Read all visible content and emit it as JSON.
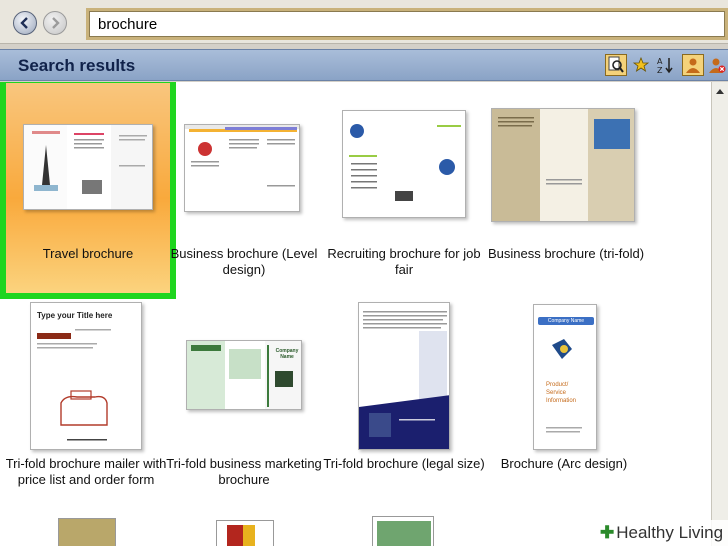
{
  "address": {
    "value": "brochure"
  },
  "header": {
    "title": "Search results"
  },
  "toolbar": {
    "view_icon": "magnifier-icon",
    "favorite_icon": "star-icon",
    "sort_icon": "sort-az-icon",
    "user_icon": "user-icon",
    "remove_user_icon": "user-remove-icon"
  },
  "templates": [
    {
      "label": "Travel brochure",
      "selected": true
    },
    {
      "label": "Business brochure (Level design)"
    },
    {
      "label": "Recruiting brochure for job fair"
    },
    {
      "label": "Business brochure (tri-fold)"
    },
    {
      "label": "Tri-fold brochure mailer with price list and order form"
    },
    {
      "label": "Tri-fold business marketing brochure"
    },
    {
      "label": "Tri-fold brochure (legal size)"
    },
    {
      "label": "Brochure (Arc design)"
    }
  ],
  "thumb_text": {
    "mailer_title": "Type your Title here",
    "arc_header": "Company Name",
    "arc_body": "Product/ Service Information",
    "marketing_head": "Company Name"
  },
  "watermark": {
    "text": "Healthy Living",
    "leaf": "✚"
  },
  "colors": {
    "selection": "#1fd51f",
    "header_bg": "#8aa3c6",
    "selected_bg": "#f9a93c"
  }
}
